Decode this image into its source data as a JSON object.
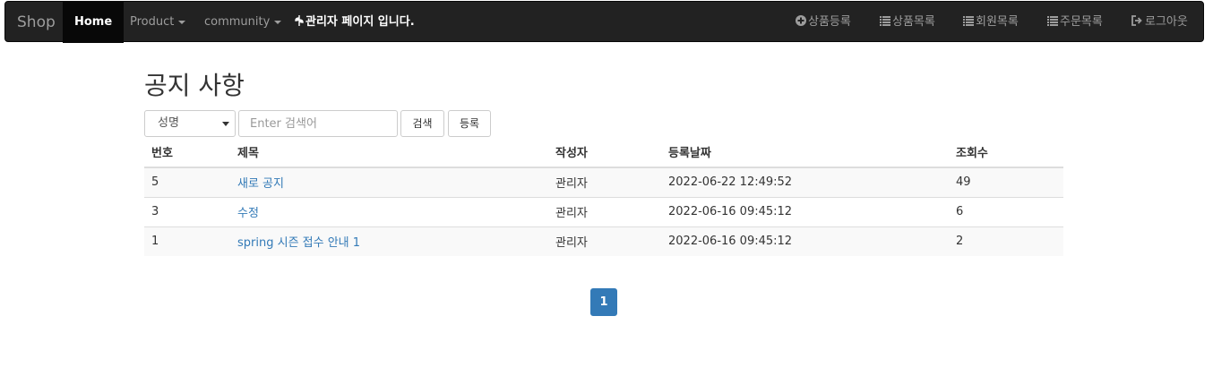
{
  "navbar": {
    "brand": "Shop",
    "home": "Home",
    "product": "Product",
    "community": "community",
    "admin_message": "관리자 페이지 입니다.",
    "right_items": [
      {
        "label": "상품등록",
        "icon": "plus-circle-icon"
      },
      {
        "label": "상품목록",
        "icon": "list-icon"
      },
      {
        "label": "회원목록",
        "icon": "list-icon"
      },
      {
        "label": "주문목록",
        "icon": "list-icon"
      },
      {
        "label": "로그아웃",
        "icon": "logout-icon"
      }
    ]
  },
  "main": {
    "title": "공지 사항",
    "search": {
      "select_value": "성명",
      "placeholder": "Enter 검색어",
      "search_label": "검색",
      "register_label": "등록"
    },
    "table": {
      "headers": [
        "번호",
        "제목",
        "작성자",
        "등록날짜",
        "조회수"
      ],
      "rows": [
        {
          "no": "5",
          "title": "새로 공지",
          "writer": "관리자",
          "date": "2022-06-22 12:49:52",
          "views": "49"
        },
        {
          "no": "3",
          "title": "수정",
          "writer": "관리자",
          "date": "2022-06-16 09:45:12",
          "views": "6"
        },
        {
          "no": "1",
          "title": "spring 시즌 접수 안내 1",
          "writer": "관리자",
          "date": "2022-06-16 09:45:12",
          "views": "2"
        }
      ]
    },
    "pagination": {
      "current": "1"
    }
  },
  "colors": {
    "navbar_bg": "#222222",
    "link": "#337ab7",
    "page_active": "#337ab7"
  }
}
